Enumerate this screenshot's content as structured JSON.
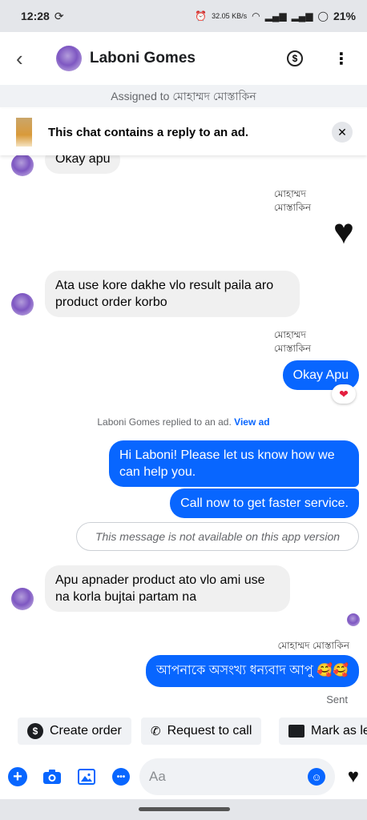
{
  "status_bar": {
    "time": "12:28",
    "net_speed": "32.05 KB/s",
    "battery": "21%"
  },
  "header": {
    "contact_name": "Laboni Gomes"
  },
  "assigned": "Assigned to মোহাম্মদ মোস্তাকিন",
  "ad_banner": {
    "text": "This chat contains a reply to an ad."
  },
  "messages": {
    "m1": "Okay apu",
    "sender1": "মোহাম্মদ\nমোস্তাকিন",
    "heart": "♥",
    "m2": "Ata use kore dakhe vlo result paila aro product order korbo",
    "sender2": "মোহাম্মদ\nমোস্তাকিন",
    "m3": "Okay Apu",
    "reaction": "❤",
    "system_text": "Laboni Gomes replied to an ad.",
    "system_link": "View ad",
    "m4": "Hi Laboni! Please let us know how we can help you.",
    "m5": "Call now to get faster service.",
    "m6": "This message is not available on this app version",
    "m7": "Apu apnader product ato vlo ami use na korla bujtai partam na",
    "sender3": "মোহাম্মদ মোস্তাকিন",
    "m8": "আপনাকে অসংখ্য ধন্যবাদ আপু 🥰🥰",
    "sent": "Sent"
  },
  "quick_replies": [
    {
      "label": "Create order",
      "icon": "dollar-icon"
    },
    {
      "label": "Request to call",
      "icon": "phone-icon"
    },
    {
      "label": "Mark as le",
      "icon": "card-icon"
    }
  ],
  "composer": {
    "placeholder": "Aa"
  },
  "colors": {
    "accent": "#0866ff",
    "incoming_bubble": "#f0f0f0",
    "reaction_heart": "#e41e3f"
  }
}
